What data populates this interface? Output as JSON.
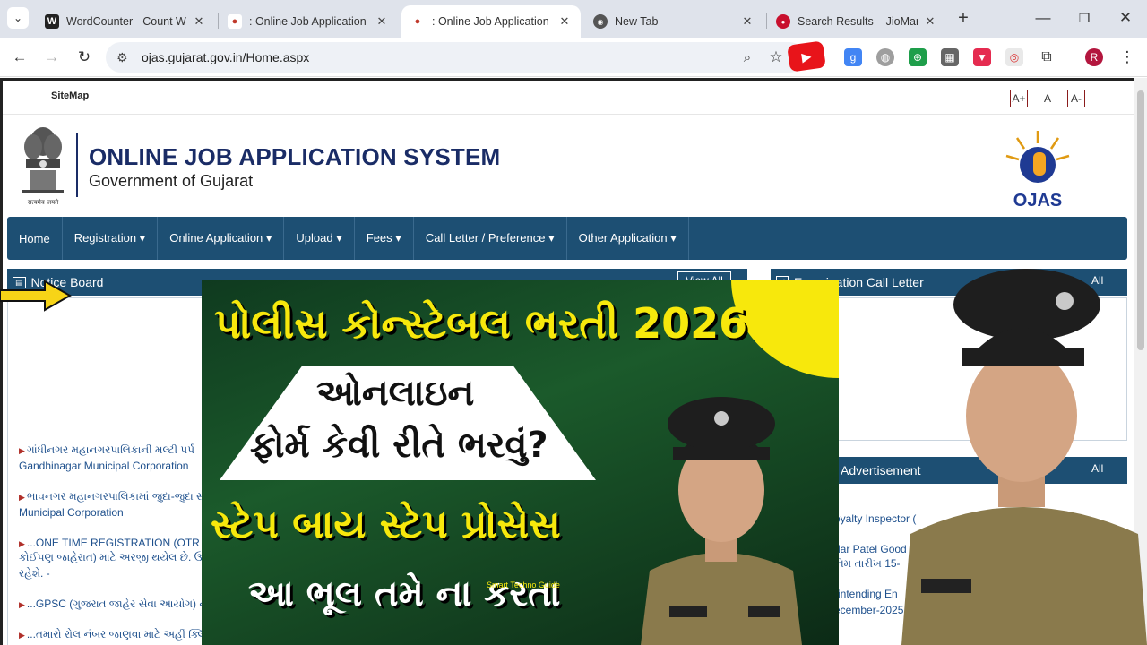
{
  "browser": {
    "tabs": [
      {
        "title": "WordCounter - Count W",
        "favicon": "W",
        "active": false
      },
      {
        "title": ": Online Job Application S",
        "favicon": "ojas",
        "active": false
      },
      {
        "title": ": Online Job Application S",
        "favicon": "ojas",
        "active": true
      },
      {
        "title": "New Tab",
        "favicon": "chrome",
        "active": false
      },
      {
        "title": "Search Results – JioMart",
        "favicon": "jiomart",
        "active": false
      }
    ],
    "new_tab_glyph": "+",
    "url": "ojas.gujarat.gov.in/Home.aspx",
    "profile_initial": "R"
  },
  "colors": {
    "nav_blue": "#1d4f73",
    "title_blue": "#1a2c66",
    "thumb_yellow": "#f7e80c"
  },
  "site": {
    "sitemap_label": "SiteMap",
    "font_controls": [
      "A+",
      "A",
      "A-"
    ],
    "title": "ONLINE JOB APPLICATION SYSTEM",
    "subtitle": "Government of Gujarat",
    "emblem_caption": "सत्यमेव जयते",
    "ojas_logo_text": "OJAS"
  },
  "nav": {
    "items": [
      {
        "label": "Home"
      },
      {
        "label": "Registration ▾"
      },
      {
        "label": "Online Application ▾"
      },
      {
        "label": "Upload ▾"
      },
      {
        "label": "Fees ▾"
      },
      {
        "label": "Call Letter / Preference ▾"
      },
      {
        "label": "Other Application ▾"
      }
    ]
  },
  "notice_board": {
    "title": "Notice Board",
    "view_all": "View All",
    "items": [
      "ગાંધીનગર મહાનગરપાલિકાની મલ્ટી પર્પ",
      "Gandhinagar Municipal Corporation",
      "ભાવનગર મહાનગરપાલિકામાં જુદા-જુદા સ",
      "Municipal Corporation",
      "...ONE TIME REGISTRATION (OTR",
      "કોઈપણ જાહેરાત) માટે અરજી થયેલ છે. ઉમે",
      "રહેશે. -",
      "...GPSC (ગુજરાત જાહેર સેવા આયોગ) ને",
      "...તમારો રોલ નંબર જાણવા માટે અહીં ક્લિ"
    ]
  },
  "call_letter": {
    "title": "Examination Call Letter",
    "view_all": "All"
  },
  "advertisement": {
    "title": "Advertisement",
    "view_all": "All",
    "items": [
      "oyalty Inspector (",
      "dar Patel Good",
      "તિમ તારીખ 15-",
      "rintending En",
      "ecember-2025"
    ]
  },
  "thumbnail": {
    "line1": "પોલીસ કોન્સ્ટેબલ ભરતી 2026",
    "line2": "ઓનલાઇન",
    "line3": "ફોર્મ કેવી રીતે ભરવું?",
    "line4": "સ્ટેપ બાય સ્ટેપ પ્રોસેસ",
    "line5": "આ ભૂલ તમે ના કરતા",
    "watermark": "Smart Techno Guide"
  }
}
